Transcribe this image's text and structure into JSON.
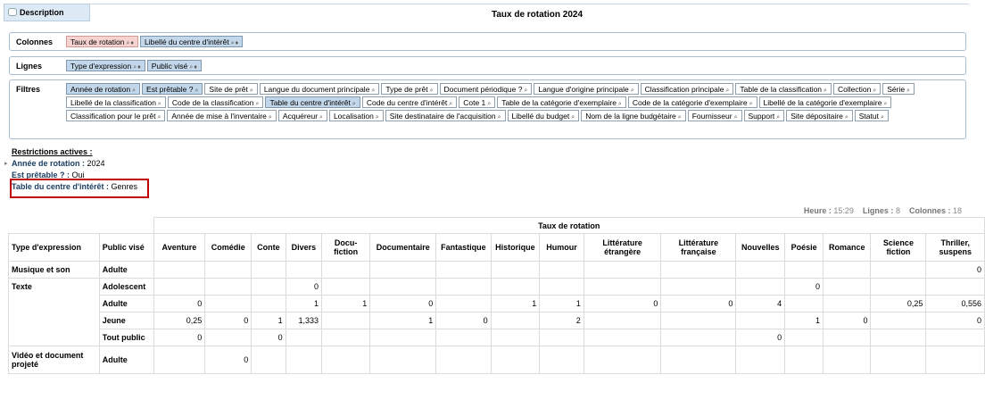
{
  "tab": {
    "label": "Description"
  },
  "title": "Taux de rotation 2024",
  "columns_box": {
    "label": "Colonnes",
    "chips": [
      {
        "label": "Taux de rotation",
        "style": "red"
      },
      {
        "label": "Libellé du centre d'intérêt",
        "style": "sel"
      }
    ]
  },
  "rows_box": {
    "label": "Lignes",
    "chips": [
      {
        "label": "Type d'expression",
        "style": "sel"
      },
      {
        "label": "Public visé",
        "style": "sel"
      }
    ]
  },
  "filters_box": {
    "label": "Filtres",
    "chips": [
      {
        "label": "Année de rotation",
        "style": "sel"
      },
      {
        "label": "Est prêtable ?",
        "style": "sel"
      },
      {
        "label": "Site de prêt",
        "style": ""
      },
      {
        "label": "Langue du document principale",
        "style": ""
      },
      {
        "label": "Type de prêt",
        "style": ""
      },
      {
        "label": "Document périodique ?",
        "style": ""
      },
      {
        "label": "Langue d'origine principale",
        "style": ""
      },
      {
        "label": "Classification principale",
        "style": ""
      },
      {
        "label": "Table de la classification",
        "style": ""
      },
      {
        "label": "Collection",
        "style": ""
      },
      {
        "label": "Série",
        "style": ""
      },
      {
        "label": "Libellé de la classification",
        "style": ""
      },
      {
        "label": "Code de la classification",
        "style": ""
      },
      {
        "label": "Table du centre d'intérêt",
        "style": "sel"
      },
      {
        "label": "Code du centre d'intérêt",
        "style": ""
      },
      {
        "label": "Cote 1",
        "style": ""
      },
      {
        "label": "Table de la catégorie d'exemplaire",
        "style": ""
      },
      {
        "label": "Code de la catégorie d'exemplaire",
        "style": ""
      },
      {
        "label": "Libellé de la catégorie d'exemplaire",
        "style": ""
      },
      {
        "label": "Classification pour le prêt",
        "style": ""
      },
      {
        "label": "Année de mise à l'inventaire",
        "style": ""
      },
      {
        "label": "Acquéreur",
        "style": ""
      },
      {
        "label": "Localisation",
        "style": ""
      },
      {
        "label": "Site destinataire de l'acquisition",
        "style": ""
      },
      {
        "label": "Libellé du budget",
        "style": ""
      },
      {
        "label": "Nom de la ligne budgétaire",
        "style": ""
      },
      {
        "label": "Fournisseur",
        "style": ""
      },
      {
        "label": "Support",
        "style": ""
      },
      {
        "label": "Site dépositaire",
        "style": ""
      },
      {
        "label": "Statut",
        "style": ""
      }
    ]
  },
  "restrictions": {
    "heading": "Restrictions actives :",
    "items": [
      {
        "key": "Année de rotation :",
        "value": "2024"
      },
      {
        "key": "Est prêtable ? :",
        "value": "Oui"
      },
      {
        "key": "Table du centre d'intérêt :",
        "value": "Genres"
      }
    ]
  },
  "meta": {
    "heure_label": "Heure :",
    "heure": "15:29",
    "lignes_label": "Lignes :",
    "lignes": "8",
    "colonnes_label": "Colonnes :",
    "colonnes": "18"
  },
  "table": {
    "group_header": "Taux de rotation",
    "row_headers": [
      "Type d'expression",
      "Public visé"
    ],
    "columns": [
      "Aventure",
      "Comédie",
      "Conte",
      "Divers",
      "Docu-fiction",
      "Documentaire",
      "Fantastique",
      "Historique",
      "Humour",
      "Littérature étrangère",
      "Littérature française",
      "Nouvelles",
      "Poésie",
      "Romance",
      "Science fiction",
      "Thriller, suspens"
    ],
    "rows": [
      {
        "type": "Musique et son",
        "public": "Adulte",
        "values": [
          "",
          "",
          "",
          "",
          "",
          "",
          "",
          "",
          "",
          "",
          "",
          "",
          "",
          "",
          "",
          "0"
        ]
      },
      {
        "type": "Texte",
        "public": "Adolescent",
        "values": [
          "",
          "",
          "",
          "0",
          "",
          "",
          "",
          "",
          "",
          "",
          "",
          "",
          "0",
          "",
          "",
          ""
        ]
      },
      {
        "type": "",
        "public": "Adulte",
        "values": [
          "0",
          "",
          "",
          "1",
          "1",
          "0",
          "",
          "1",
          "1",
          "0",
          "0",
          "4",
          "",
          "",
          "0,25",
          "0,556"
        ]
      },
      {
        "type": "",
        "public": "Jeune",
        "values": [
          "0,25",
          "0",
          "1",
          "1,333",
          "",
          "1",
          "0",
          "",
          "2",
          "",
          "",
          "",
          "1",
          "0",
          "",
          "0"
        ]
      },
      {
        "type": "",
        "public": "Tout public",
        "values": [
          "0",
          "",
          "0",
          "",
          "",
          "",
          "",
          "",
          "",
          "",
          "",
          "0",
          "",
          "",
          "",
          ""
        ]
      },
      {
        "type": "Vidéo et document projeté",
        "public": "Adulte",
        "values": [
          "",
          "0",
          "",
          "",
          "",
          "",
          "",
          "",
          "",
          "",
          "",
          "",
          "",
          "",
          "",
          ""
        ]
      }
    ]
  }
}
